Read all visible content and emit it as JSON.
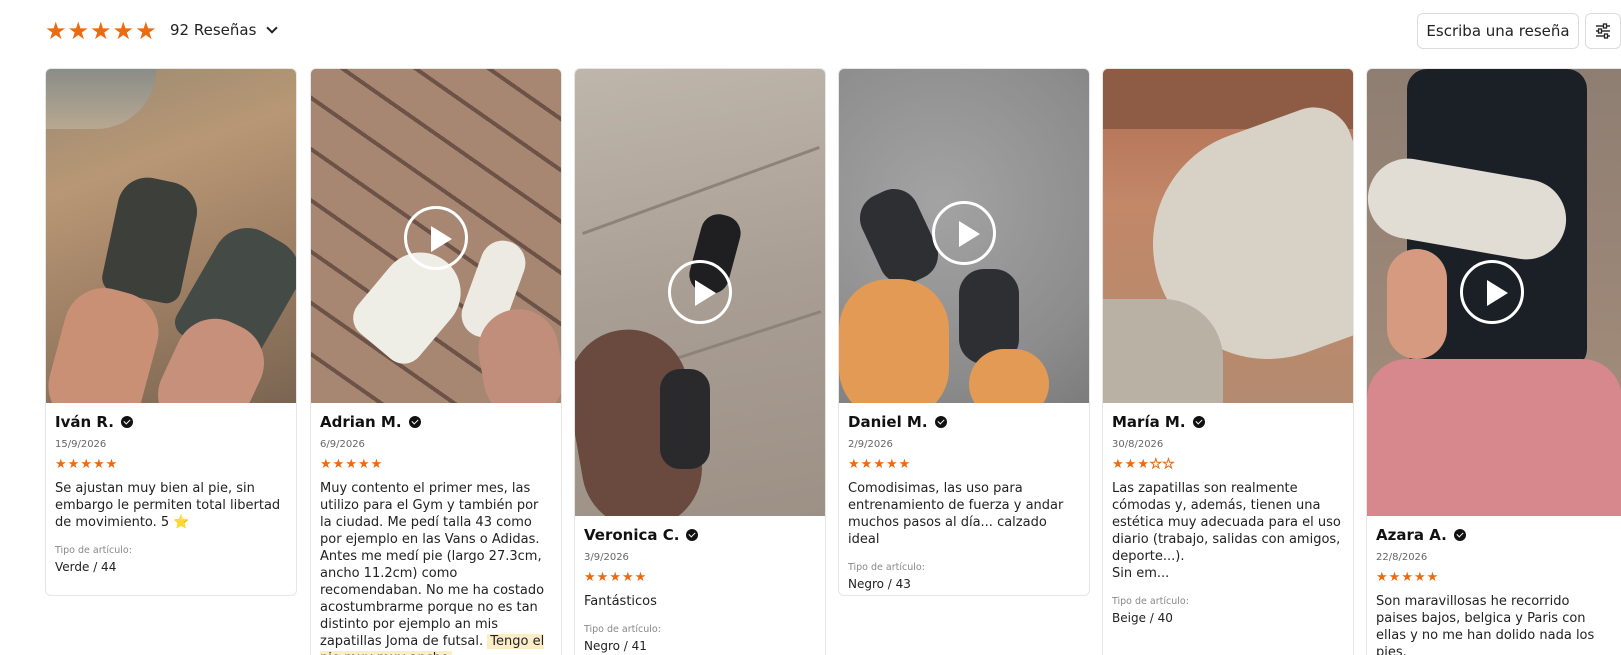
{
  "summary": {
    "rating_stars": 5,
    "review_count": "92 Reseñas",
    "accent_color": "#ee6a0f"
  },
  "toolbar": {
    "write_review": "Escriba una reseña",
    "filter_icon": "sliders-icon"
  },
  "reviews": [
    {
      "name": "Iván R.",
      "date": "15/9/2026",
      "rating": 5,
      "text": "Se ajustan muy bien al pie, sin embargo le permiten total libertad de movimiento. 5 ⭐",
      "attr_label": "Tipo de artículo:",
      "attr_value": "Verde / 44",
      "has_video": false
    },
    {
      "name": "Adrian M.",
      "date": "6/9/2026",
      "rating": 5,
      "text": "Muy contento el primer mes, las utilizo para el Gym y también por la ciudad. Me pedí talla 43 como por ejemplo en las Vans o Adidas. Antes me medí pie (largo 27.3cm, ancho 11.2cm) como recomendaban. No me ha costado acostumbrarme porque no es tan distinto por ejemplo an mis zapatillas Joma de futsal.",
      "highlight": "Tengo el pie muy muy ancho",
      "has_video": true
    },
    {
      "name": "Veronica C.",
      "date": "3/9/2026",
      "rating": 5,
      "text": "Fantásticos",
      "attr_label": "Tipo de artículo:",
      "attr_value": "Negro / 41",
      "has_video": true
    },
    {
      "name": "Daniel M.",
      "date": "2/9/2026",
      "rating": 5,
      "text": "Comodisimas, las uso para entrenamiento de fuerza y andar muchos pasos al día... calzado ideal",
      "attr_label": "Tipo de artículo:",
      "attr_value": "Negro / 43",
      "has_video": true
    },
    {
      "name": "María M.",
      "date": "30/8/2026",
      "rating": 3,
      "text": "Las zapatillas son realmente cómodas y, además, tienen una estética muy adecuada para el uso diario (trabajo, salidas con amigos, deporte...).",
      "text_more": "Sin em...",
      "attr_label": "Tipo de artículo:",
      "attr_value": "Beige / 40",
      "has_video": false
    },
    {
      "name": "Azara A.",
      "date": "22/8/2026",
      "rating": 5,
      "text": "Son maravillosas he recorrido paises bajos, belgica y Paris con ellas y no me han dolido nada los pies.",
      "has_video": true
    }
  ]
}
